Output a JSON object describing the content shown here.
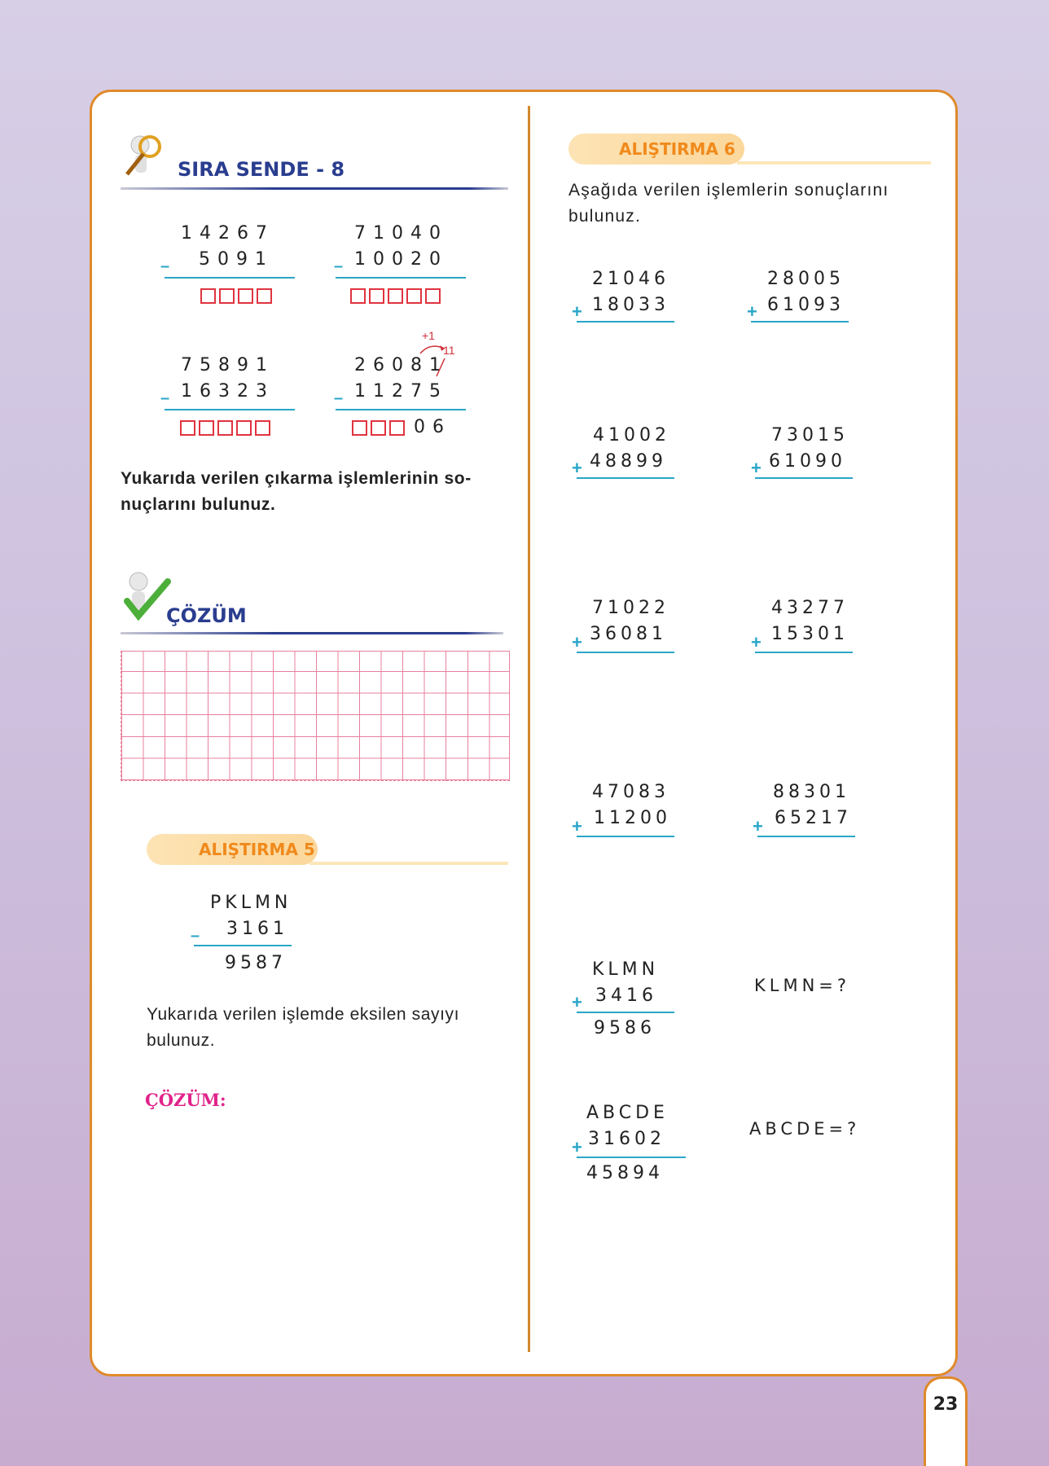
{
  "sira_sende": {
    "title": "SIRA SENDE - 8",
    "problems": [
      {
        "top": "14267",
        "bottom": "5091"
      },
      {
        "top": "71040",
        "bottom": "10020"
      },
      {
        "top": "75891",
        "bottom": "16323"
      },
      {
        "top": "26081",
        "bottom": "11275",
        "partial": "06",
        "borrow_plus": "+1",
        "borrow_eleven": "11"
      }
    ],
    "instruction": "Yukarıda verilen çıkarma işlemlerinin so-nuçlarını bulunuz."
  },
  "cozum_title": "ÇÖZÜM",
  "alistirma5": {
    "title": "ALIŞTIRMA 5",
    "top": "PKLMN",
    "bottom": "3161",
    "result": "9587",
    "text": "Yukarıda verilen işlemde eksilen sayıyı bulunuz.",
    "solution_label": "ÇÖZÜM:"
  },
  "alistirma6": {
    "title": "ALIŞTIRMA 6",
    "instruction": "Aşağıda verilen işlemlerin sonuçlarını bulunuz.",
    "problems": [
      {
        "top": "21046",
        "bottom": "18033"
      },
      {
        "top": "28005",
        "bottom": "61093"
      },
      {
        "top": "41002",
        "bottom": "48899"
      },
      {
        "top": "73015",
        "bottom": "61090"
      },
      {
        "top": "71022",
        "bottom": "36081"
      },
      {
        "top": "43277",
        "bottom": "15301"
      },
      {
        "top": "47083",
        "bottom": "11200"
      },
      {
        "top": "88301",
        "bottom": "65217"
      }
    ],
    "klmn": {
      "top": "KLMN",
      "bottom": "3416",
      "result": "9586",
      "question": "KLMN=?"
    },
    "abcde": {
      "top": "ABCDE",
      "bottom": "31602",
      "result": "45894",
      "question": "ABCDE=?"
    }
  },
  "page_number": "23"
}
